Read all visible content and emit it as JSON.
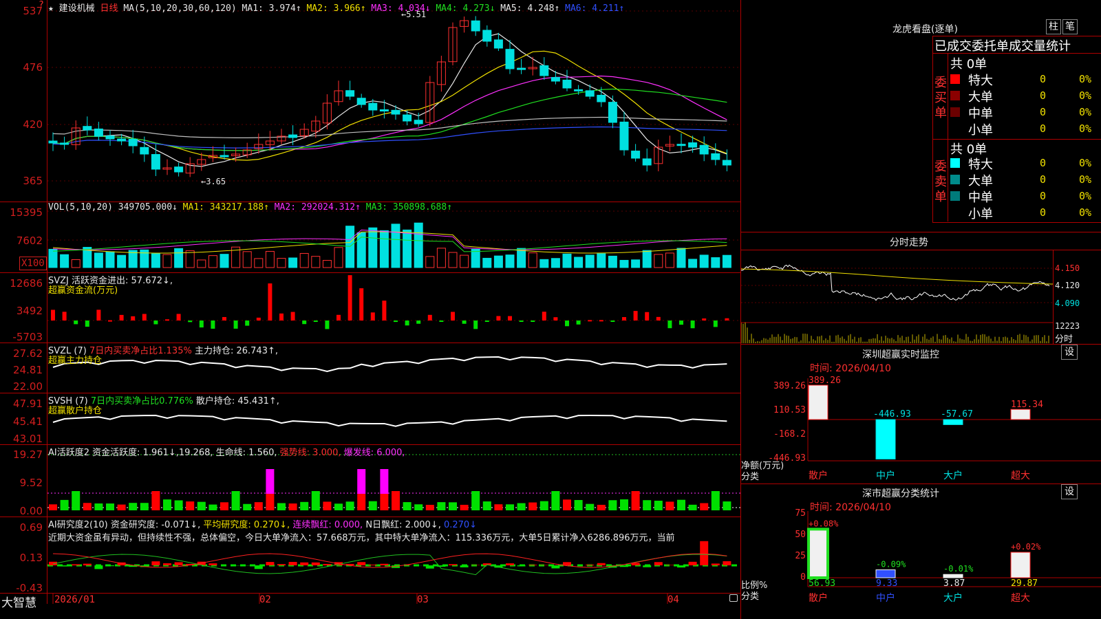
{
  "main": {
    "header": {
      "star": "★",
      "name": "建设机械",
      "period": "日线",
      "ma_def": "MA(5,10,20,30,60,120)",
      "ma1": "MA1: 3.974↑",
      "ma2": "MA2: 3.966↑",
      "ma3": "MA3: 4.034↓",
      "ma4": "MA4: 4.273↓",
      "ma5": "MA5: 4.248↑",
      "ma6": "MA6: 4.211↑"
    },
    "y_labels": [
      "537",
      "476",
      "420",
      "365"
    ],
    "high_label": "5.51",
    "low_label": "3.65",
    "top_marker": "?"
  },
  "vol": {
    "header_def": "VOL(5,10,20)",
    "value": "349705.000↓",
    "ma1": "MA1: 343217.188↑",
    "ma2": "MA2: 292024.312↑",
    "ma3": "MA3: 350898.688↑",
    "y_labels": [
      "15395",
      "7602"
    ],
    "unit": "X100"
  },
  "svzj": {
    "header": "SVZJ  活跃资金进出: 57.672↓,",
    "sub": "超赢资金流(万元)",
    "y_labels": [
      "12686",
      "3492",
      "-5703"
    ]
  },
  "svzl": {
    "label": "SVZL (7)",
    "ratio": "7日内买卖净占比1.135%",
    "hold": "主力持仓: 26.743↑,",
    "sub": "超赢主力持仓",
    "y_labels": [
      "27.62",
      "24.81",
      "22.00"
    ]
  },
  "svsh": {
    "label": "SVSH (7)",
    "ratio": "7日内买卖净占比0.776%",
    "hold": "散户持仓: 45.431↑,",
    "sub": "超赢散户持仓",
    "y_labels": [
      "47.91",
      "45.41",
      "43.01"
    ]
  },
  "ai_active": {
    "label": "AI活跃度2",
    "v1": "资金活跃度: 1.961↓,19.268,",
    "v2": "生命线: 1.560,",
    "v3": "强势线: 3.000,",
    "v4": "爆发线: 6.000,",
    "y_labels": [
      "19.27",
      "9.52",
      "0.00"
    ]
  },
  "ai_research": {
    "label": "AI研究度2(10)",
    "v1": "资金研究度: -0.071↓,",
    "v2": "平均研究度: 0.270↓,",
    "v3": "连续飘红: 0.000,",
    "v4": "N日飘红: 2.000↓,",
    "v5": "0.270↓",
    "text": "近期大资金虽有异动，但持续性不强，总体偏空，今日大单净流入：57.668万元，其中特大单净流入：115.336万元，大单5日累计净入6286.896万元，当前",
    "y_labels": [
      "0.69",
      "0.13",
      "-0.43"
    ]
  },
  "bottom": {
    "brand": "大智慧",
    "dates": [
      "2026/01",
      "02",
      "03",
      "04"
    ]
  },
  "right": {
    "dragon_title": "龙虎看盘(逐单)",
    "btn_zhu": "柱",
    "btn_bi": "笔",
    "deal_title": "已成交委托单成交量统计",
    "buy_total": "共 0单",
    "sell_total": "共 0单",
    "buy_side": "委买单",
    "sell_side": "委卖单",
    "buy_rows": [
      {
        "label": "特大",
        "count": "0",
        "pct": "0%",
        "color": "#ff0000"
      },
      {
        "label": "大单",
        "count": "0",
        "pct": "0%",
        "color": "#8b0000"
      },
      {
        "label": "中单",
        "count": "0",
        "pct": "0%",
        "color": "#6b0000"
      },
      {
        "label": "小单",
        "count": "0",
        "pct": "0%",
        "color": "#000000"
      }
    ],
    "sell_rows": [
      {
        "label": "特大",
        "count": "0",
        "pct": "0%",
        "color": "#00ffff"
      },
      {
        "label": "大单",
        "count": "0",
        "pct": "0%",
        "color": "#008b8b"
      },
      {
        "label": "中单",
        "count": "0",
        "pct": "0%",
        "color": "#007b7b"
      },
      {
        "label": "小单",
        "count": "0",
        "pct": "0%",
        "color": "#000000"
      }
    ],
    "intraday_title": "分时走势",
    "intraday_y": [
      "4.150",
      "4.120",
      "4.090"
    ],
    "intraday_vol": "12223",
    "intraday_label": "分时",
    "monitor_title": "深圳超赢实时监控",
    "monitor_btn": "设",
    "monitor_time": "时间: 2026/04/10",
    "monitor_y": [
      "389.26",
      "110.53",
      "-168.2",
      "-446.93"
    ],
    "monitor_unit": "净额(万元)",
    "monitor_cat": "分类",
    "monitor_values": [
      "389.26",
      "-446.93",
      "-57.67",
      "115.34"
    ],
    "categories": [
      "散户",
      "中户",
      "大户",
      "超大"
    ],
    "stats_title": "深市超赢分类统计",
    "stats_btn": "设",
    "stats_time": "时间: 2026/04/10",
    "stats_y": [
      "75",
      "50",
      "25",
      "0"
    ],
    "stats_deltas": [
      "+0.08%",
      "-0.09%",
      "-0.01%",
      "+0.02%"
    ],
    "stats_values": [
      "56.93",
      "9.33",
      "3.87",
      "29.87"
    ],
    "stats_unit": "比例%",
    "stats_cat": "分类"
  },
  "colors": {
    "up": "#ff3030",
    "down": "#00e0e0",
    "grid": "#b00000"
  }
}
